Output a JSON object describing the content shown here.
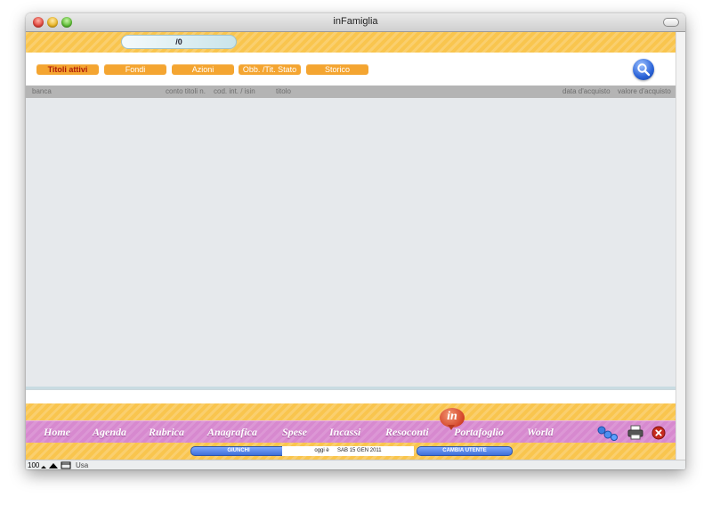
{
  "window": {
    "title": "inFamiglia"
  },
  "counter": {
    "value": "/0"
  },
  "tabs": [
    {
      "label": "Titoli attivi",
      "active": true
    },
    {
      "label": "Fondi",
      "active": false
    },
    {
      "label": "Azioni",
      "active": false
    },
    {
      "label": "Obb. /Tit. Stato",
      "active": false
    },
    {
      "label": "Storico",
      "active": false
    }
  ],
  "columns": {
    "banca": "banca",
    "conto": "conto titoli n.",
    "cod": "cod. int. / isin",
    "titolo": "titolo",
    "data": "data d'acquisto",
    "valore": "valore d'acquisto"
  },
  "logo": {
    "text": "in"
  },
  "nav": {
    "items": [
      "Home",
      "Agenda",
      "Rubrica",
      "Anagrafica",
      "Spese",
      "Incassi",
      "Resoconti",
      "Portafoglio",
      "World"
    ]
  },
  "status": {
    "left_button": "GIUNCHI",
    "today_label": "oggi è",
    "date": "SAB 15 GEN 2011",
    "right_button": "CAMBIA UTENTE"
  },
  "bottom": {
    "zoom": "100",
    "mode": "Usa"
  },
  "colors": {
    "accent": "#f4a531",
    "band": "#f9c54e",
    "nav": "#d789cf",
    "table": "#e6e9ec"
  },
  "icons": {
    "search": "magnifier-icon",
    "users": "users-icon",
    "print": "printer-icon",
    "close": "close-icon"
  }
}
